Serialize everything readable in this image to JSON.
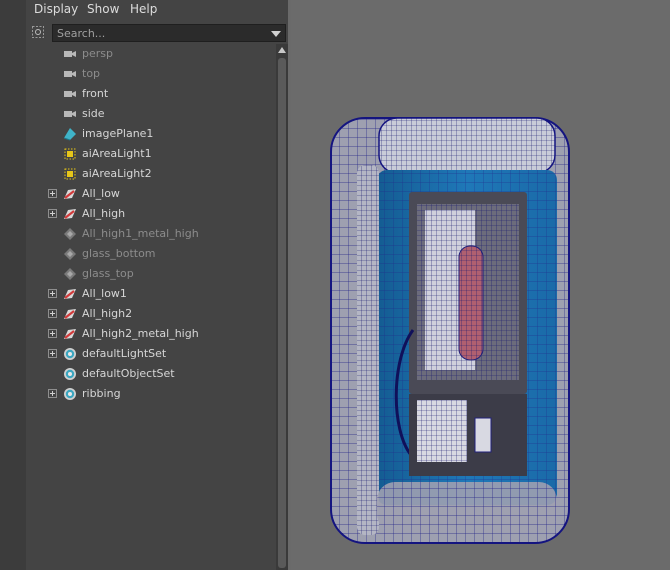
{
  "menubar": {
    "display": "Display",
    "show": "Show",
    "help": "Help"
  },
  "search": {
    "placeholder": "Search..."
  },
  "outliner": {
    "items": [
      {
        "label": "persp",
        "icon": "camera-icon",
        "dim": true,
        "expandable": false
      },
      {
        "label": "top",
        "icon": "camera-icon",
        "dim": true,
        "expandable": false
      },
      {
        "label": "front",
        "icon": "camera-icon",
        "dim": false,
        "expandable": false
      },
      {
        "label": "side",
        "icon": "camera-icon",
        "dim": false,
        "expandable": false
      },
      {
        "label": "imagePlane1",
        "icon": "image-plane-icon",
        "dim": false,
        "expandable": false
      },
      {
        "label": "aiAreaLight1",
        "icon": "area-light-icon",
        "dim": false,
        "expandable": false
      },
      {
        "label": "aiAreaLight2",
        "icon": "area-light-icon",
        "dim": false,
        "expandable": false
      },
      {
        "label": "All_low",
        "icon": "group-transform-icon",
        "dim": false,
        "expandable": true
      },
      {
        "label": "All_high",
        "icon": "group-transform-icon",
        "dim": false,
        "expandable": true
      },
      {
        "label": "All_high1_metal_high",
        "icon": "transform-node-icon",
        "dim": true,
        "expandable": false
      },
      {
        "label": "glass_bottom",
        "icon": "transform-node-icon",
        "dim": true,
        "expandable": false
      },
      {
        "label": "glass_top",
        "icon": "transform-node-icon",
        "dim": true,
        "expandable": false
      },
      {
        "label": "All_low1",
        "icon": "group-transform-icon",
        "dim": false,
        "expandable": true
      },
      {
        "label": "All_high2",
        "icon": "group-transform-icon",
        "dim": false,
        "expandable": true
      },
      {
        "label": "All_high2_metal_high",
        "icon": "group-transform-icon",
        "dim": false,
        "expandable": true
      },
      {
        "label": "defaultLightSet",
        "icon": "set-icon",
        "dim": false,
        "expandable": true
      },
      {
        "label": "defaultObjectSet",
        "icon": "set-icon",
        "dim": false,
        "expandable": false
      },
      {
        "label": "ribbing",
        "icon": "set-icon",
        "dim": false,
        "expandable": true
      }
    ]
  },
  "colors": {
    "panel_bg": "#444444",
    "viewport_bg": "#6b6b6b",
    "wireframe": "#1a1a9a",
    "glass": "#1f6fb0",
    "dim_text": "#8c8c8c",
    "light_icon": "#e6c619"
  }
}
